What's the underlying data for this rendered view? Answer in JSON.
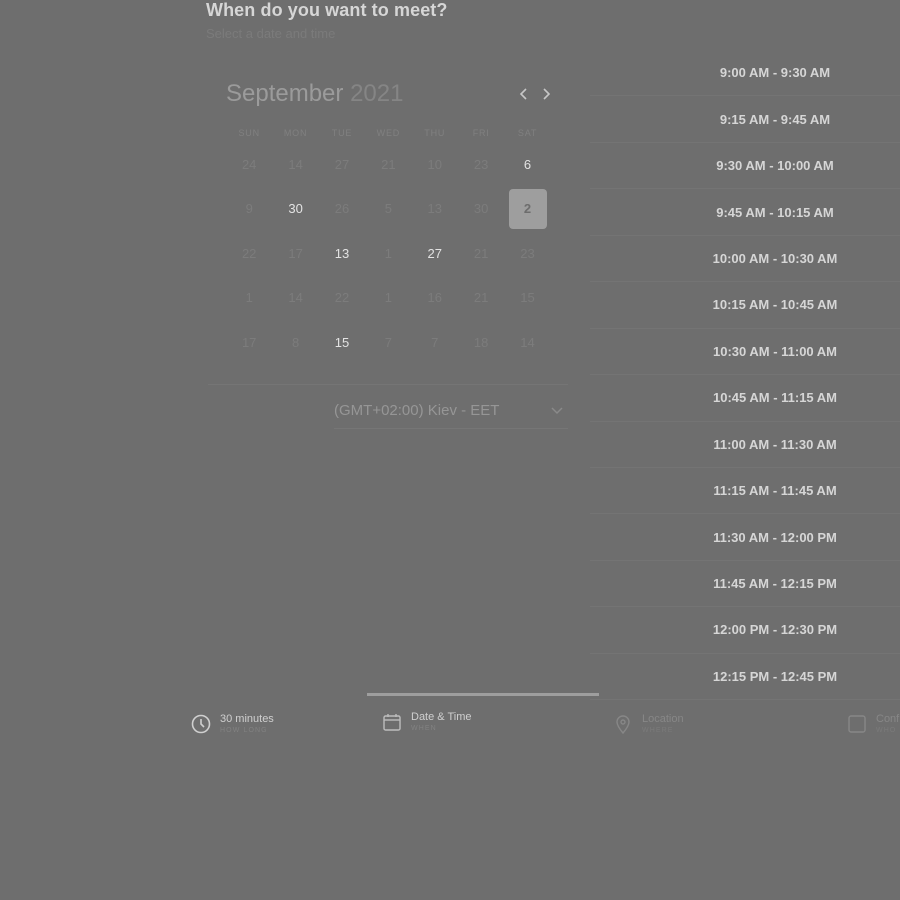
{
  "header": {
    "title": "When do you want to meet?",
    "subtitle": "Select a date and time"
  },
  "calendar": {
    "month": "September",
    "year": "2021",
    "weekdays": [
      "SUN",
      "MON",
      "TUE",
      "WED",
      "THU",
      "FRI",
      "SAT"
    ],
    "days": [
      {
        "label": "24",
        "state": "disabled"
      },
      {
        "label": "14",
        "state": "disabled"
      },
      {
        "label": "27",
        "state": "disabled"
      },
      {
        "label": "21",
        "state": "disabled"
      },
      {
        "label": "10",
        "state": "disabled"
      },
      {
        "label": "23",
        "state": "disabled"
      },
      {
        "label": "6",
        "state": "available"
      },
      {
        "label": "9",
        "state": "disabled"
      },
      {
        "label": "30",
        "state": "available"
      },
      {
        "label": "26",
        "state": "disabled"
      },
      {
        "label": "5",
        "state": "disabled"
      },
      {
        "label": "13",
        "state": "disabled"
      },
      {
        "label": "30",
        "state": "disabled"
      },
      {
        "label": "2",
        "state": "selected"
      },
      {
        "label": "22",
        "state": "disabled"
      },
      {
        "label": "17",
        "state": "disabled"
      },
      {
        "label": "13",
        "state": "available"
      },
      {
        "label": "1",
        "state": "disabled"
      },
      {
        "label": "27",
        "state": "available"
      },
      {
        "label": "21",
        "state": "disabled"
      },
      {
        "label": "23",
        "state": "disabled"
      },
      {
        "label": "1",
        "state": "disabled"
      },
      {
        "label": "14",
        "state": "disabled"
      },
      {
        "label": "22",
        "state": "disabled"
      },
      {
        "label": "1",
        "state": "disabled"
      },
      {
        "label": "16",
        "state": "disabled"
      },
      {
        "label": "21",
        "state": "disabled"
      },
      {
        "label": "15",
        "state": "disabled"
      },
      {
        "label": "17",
        "state": "disabled"
      },
      {
        "label": "8",
        "state": "disabled"
      },
      {
        "label": "15",
        "state": "available"
      },
      {
        "label": "7",
        "state": "disabled"
      },
      {
        "label": "7",
        "state": "disabled"
      },
      {
        "label": "18",
        "state": "disabled"
      },
      {
        "label": "14",
        "state": "disabled"
      }
    ]
  },
  "timezone": {
    "value": "(GMT+02:00) Kiev - EET"
  },
  "time_slots": [
    "9:00 AM - 9:30 AM",
    "9:15 AM - 9:45 AM",
    "9:30 AM - 10:00 AM",
    "9:45 AM - 10:15 AM",
    "10:00 AM - 10:30 AM",
    "10:15 AM - 10:45 AM",
    "10:30 AM - 11:00 AM",
    "10:45 AM - 11:15 AM",
    "11:00 AM - 11:30 AM",
    "11:15 AM - 11:45 AM",
    "11:30 AM - 12:00 PM",
    "11:45 AM - 12:15 PM",
    "12:00 PM - 12:30 PM",
    "12:15 PM - 12:45 PM"
  ],
  "steps": {
    "duration": {
      "label": "30 minutes",
      "sub": "HOW LONG",
      "icon": "clock-icon"
    },
    "datetime": {
      "label": "Date & Time",
      "sub": "WHEN",
      "icon": "calendar-icon"
    },
    "location": {
      "label": "Location",
      "sub": "WHERE",
      "icon": "location-pin-icon"
    },
    "confirm": {
      "label": "Conf",
      "sub": "WHO",
      "icon": "checkbox-icon"
    }
  },
  "colors": {
    "background": "#6e6e6e",
    "selected_day_bg": "#9e9e9e",
    "progress": "#9e9e9e"
  }
}
